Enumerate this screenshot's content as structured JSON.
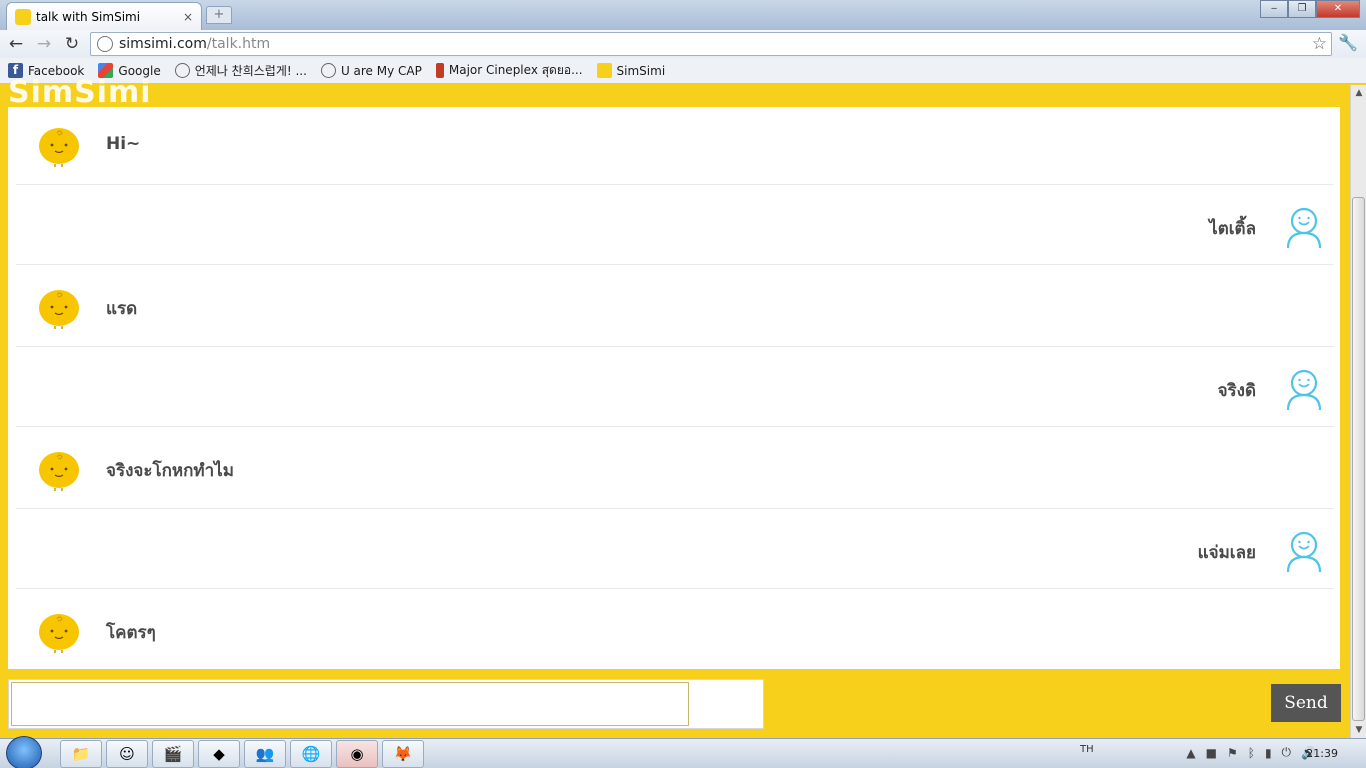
{
  "browser": {
    "tab_title": "talk with SimSimi",
    "url_host": "simsimi.com",
    "url_path": "/talk.htm",
    "bookmarks": [
      {
        "label": "Facebook",
        "icon": "facebook-icon"
      },
      {
        "label": "Google",
        "icon": "google-icon"
      },
      {
        "label": "언제나 찬희스럽게! ...",
        "icon": "globe-icon"
      },
      {
        "label": "U are My CAP",
        "icon": "globe-icon"
      },
      {
        "label": "Major Cineplex สุดยอ...",
        "icon": "major-cineplex-icon"
      },
      {
        "label": "SimSimi",
        "icon": "simsimi-icon"
      }
    ]
  },
  "page": {
    "logo": "SimSimi",
    "messages": [
      {
        "from": "sim",
        "text": "Hi~"
      },
      {
        "from": "user",
        "text": "ไตเติ้ล"
      },
      {
        "from": "sim",
        "text": "แรด"
      },
      {
        "from": "user",
        "text": "จริงดิ"
      },
      {
        "from": "sim",
        "text": "จริงจะโกหกทำไม"
      },
      {
        "from": "user",
        "text": "แจ่มเลย"
      },
      {
        "from": "sim",
        "text": "โคตรๆ"
      }
    ],
    "input_value": "",
    "send_label": "Send"
  },
  "taskbar": {
    "language": "TH",
    "clock": "21:39"
  },
  "colors": {
    "brand_yellow": "#f7d01c",
    "send_button": "#555555",
    "user_icon": "#4fc3e8"
  }
}
